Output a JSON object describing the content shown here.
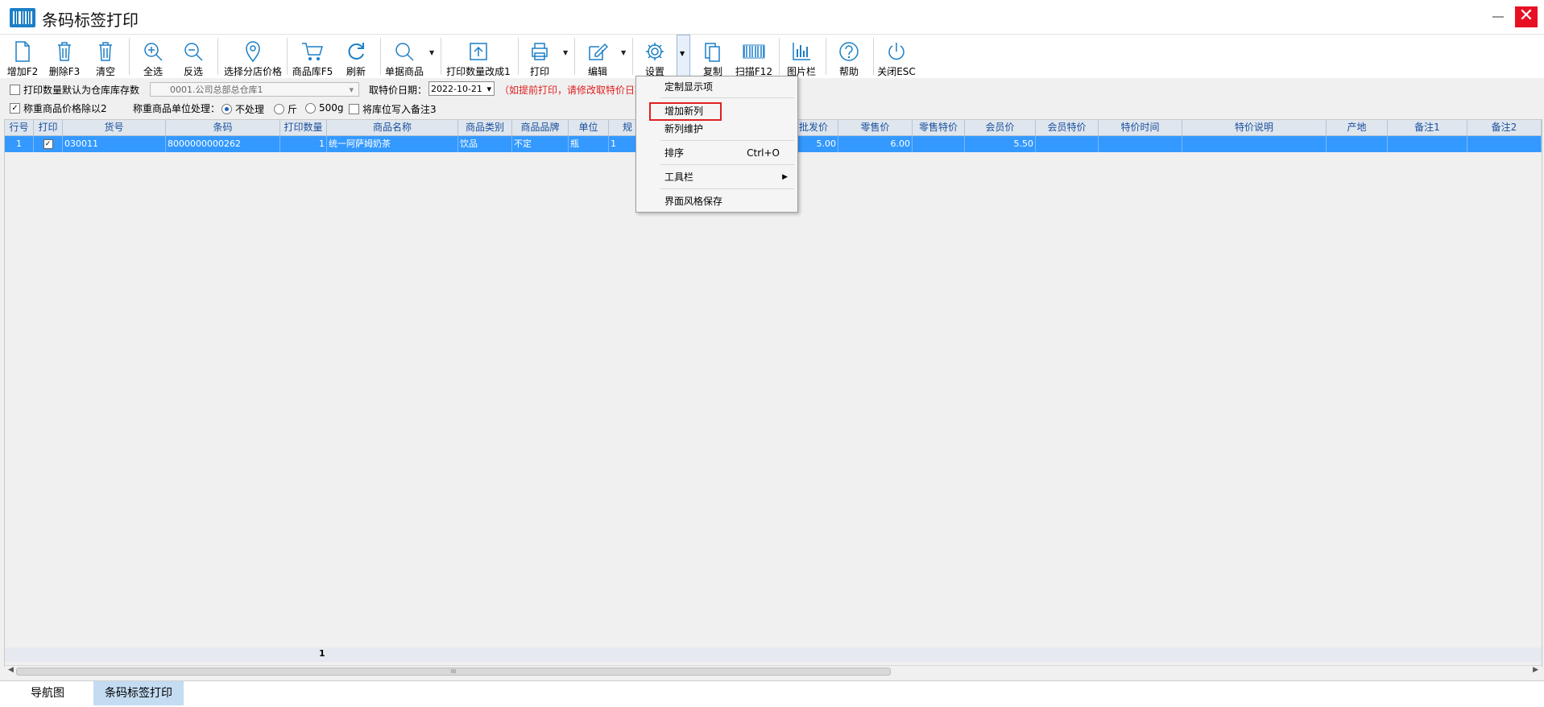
{
  "window": {
    "title": "条码标签打印",
    "close_glyph": "✕"
  },
  "toolbar": {
    "add": "增加F2",
    "delete": "删除F3",
    "clear": "清空",
    "select_all": "全选",
    "invert": "反选",
    "branch_price": "选择分店价格",
    "product_lib": "商品库F5",
    "refresh": "刷新",
    "single_product": "单据商品",
    "print_qty": "打印数量改成1",
    "print": "打印",
    "edit": "编辑",
    "settings": "设置",
    "copy": "复制",
    "scan": "扫描F12",
    "image_bar": "图片栏",
    "help": "帮助",
    "close": "关闭ESC"
  },
  "options": {
    "default_qty_label": "打印数量默认为仓库库存数",
    "warehouse": "0001.公司总部总仓库1",
    "special_date_label": "取特价日期：",
    "special_date": "2022-10-21",
    "notice": "（如提前打印，请修改取特价日期",
    "weigh_divide_label": "称重商品价格除以2",
    "weigh_unit_label": "称重商品单位处理：",
    "radio_none": "不处理",
    "radio_jin": "斤",
    "radio_500g": "500g",
    "write_location_label": "将库位写入备注3"
  },
  "grid": {
    "headers": [
      "行号",
      "打印",
      "货号",
      "条码",
      "打印数量",
      "商品名称",
      "商品类别",
      "商品品牌",
      "单位",
      "规",
      "批发价",
      "零售价",
      "零售特价",
      "会员价",
      "会员特价",
      "特价时间",
      "特价说明",
      "产地",
      "备注1",
      "备注2"
    ],
    "row": {
      "line": "1",
      "check": "✓",
      "item_no": "030011",
      "barcode": "8000000000262",
      "qty": "1",
      "name": "统一阿萨姆奶茶",
      "category": "饮品",
      "brand": "不定",
      "unit": "瓶",
      "spec": "1",
      "wholesale": "5.00",
      "retail": "6.00",
      "member": "5.50"
    },
    "footer_count": "1",
    "scroll_grip": "III"
  },
  "context_menu": {
    "custom_display": "定制显示项",
    "add_column": "增加新列",
    "maintain_column": "新列维护",
    "sort": "排序",
    "sort_shortcut": "Ctrl+O",
    "toolbar": "工具栏",
    "save_style": "界面风格保存"
  },
  "tabs": {
    "nav": "导航图",
    "barcode": "条码标签打印"
  },
  "colors": {
    "accent": "#1c7fc7",
    "selection": "#3399ff",
    "close": "#e81123",
    "highlight_box": "#e02020"
  }
}
